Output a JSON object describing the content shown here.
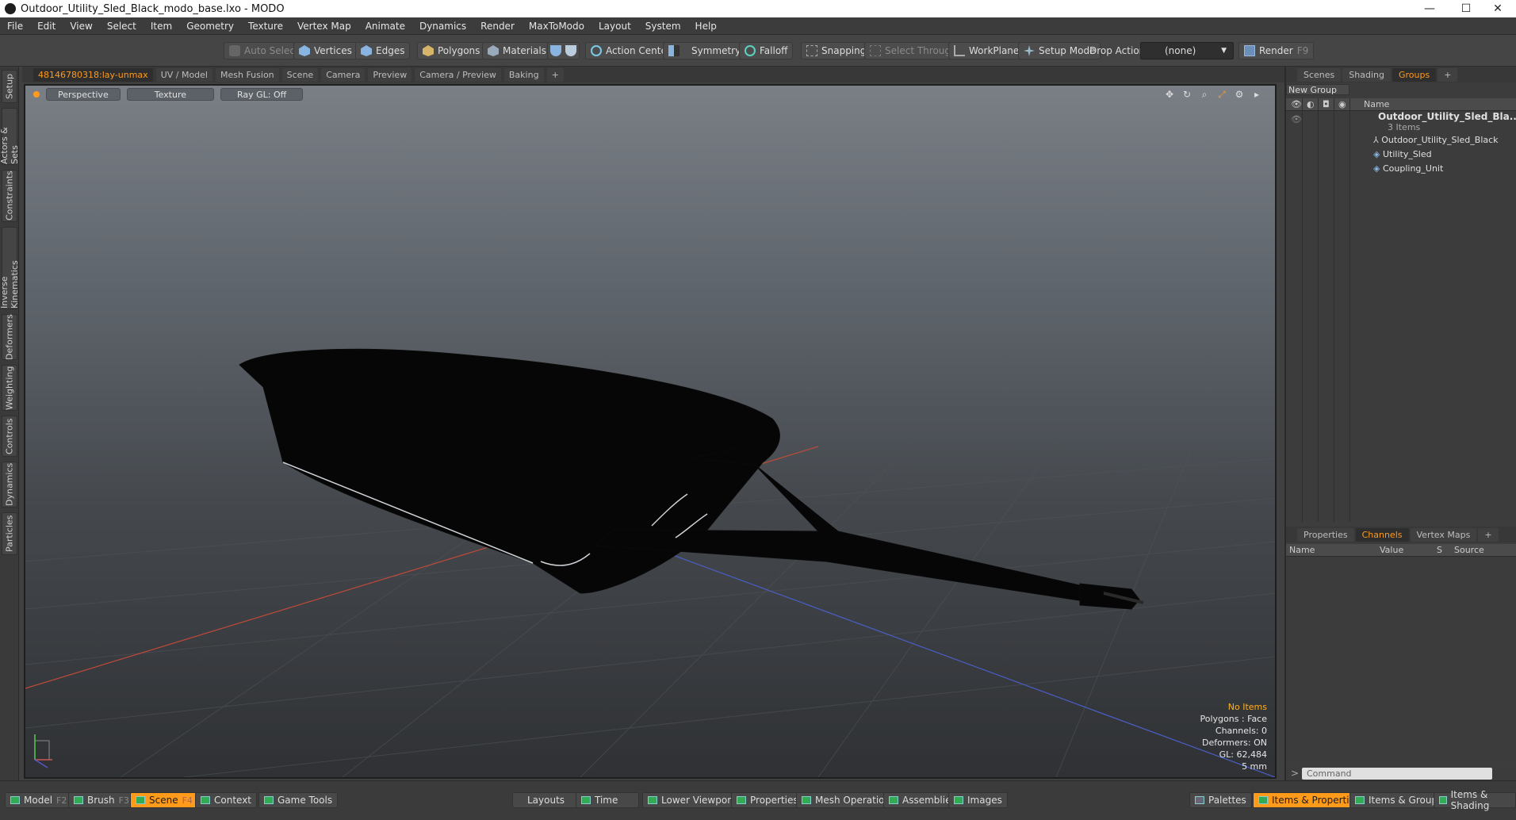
{
  "window": {
    "title": "Outdoor_Utility_Sled_Black_modo_base.lxo - MODO"
  },
  "menu": [
    "File",
    "Edit",
    "View",
    "Select",
    "Item",
    "Geometry",
    "Texture",
    "Vertex Map",
    "Animate",
    "Dynamics",
    "Render",
    "MaxToModo",
    "Layout",
    "System",
    "Help"
  ],
  "toolbar": {
    "auto_select": "Auto Select",
    "vertices": "Vertices",
    "edges": "Edges",
    "polygons": "Polygons",
    "materials": "Materials",
    "action_center": "Action Center",
    "symmetry": "Symmetry",
    "falloff": "Falloff",
    "snapping": "Snapping",
    "select_through": "Select Through",
    "workplane": "WorkPlane",
    "setup_mode": "Setup Mode",
    "drop_action": "Drop Action",
    "drop_value": "(none)",
    "render": "Render",
    "render_key": "F9"
  },
  "left_tabs": [
    "Setup",
    "Actors & Sets",
    "Constraints",
    "Inverse Kinematics",
    "Deformers",
    "Weighting",
    "Controls",
    "Dynamics",
    "Particles"
  ],
  "viewport_tabs": [
    "48146780318:lay-unmax",
    "UV / Model",
    "Mesh Fusion",
    "Scene",
    "Camera",
    "Preview",
    "Camera / Preview",
    "Baking",
    "+"
  ],
  "viewport": {
    "perspective": "Perspective",
    "texture": "Texture",
    "raygl": "Ray GL: Off",
    "info": {
      "items": "No Items",
      "polygons": "Polygons : Face",
      "channels": "Channels: 0",
      "deformers": "Deformers: ON",
      "gl": "GL: 62,484",
      "scale": "5 mm"
    }
  },
  "right_tabs": [
    "Scenes",
    "Shading",
    "Groups",
    "+"
  ],
  "groups": {
    "new_group": "New Group",
    "name_header": "Name",
    "root": "Outdoor_Utility_Sled_Bla...",
    "root_count": "3 Items",
    "children": [
      "Outdoor_Utility_Sled_Black",
      "Utility_Sled",
      "Coupling_Unit"
    ]
  },
  "channel_tabs": [
    "Properties",
    "Channels",
    "Vertex Maps",
    "+"
  ],
  "channels": {
    "name": "Name",
    "value": "Value",
    "s": "S",
    "source": "Source"
  },
  "command": {
    "placeholder": "Command"
  },
  "bottom": {
    "model": "Model",
    "model_key": "F2",
    "brush": "Brush",
    "brush_key": "F3",
    "scene": "Scene",
    "scene_key": "F4",
    "context": "Context",
    "game_tools": "Game Tools",
    "layouts": "Layouts",
    "time": "Time",
    "lower_viewports": "Lower Viewports",
    "properties": "Properties",
    "mesh_operations": "Mesh Operations",
    "assemblies": "Assemblies",
    "images": "Images",
    "palettes": "Palettes",
    "items_properties": "Items & Properties",
    "items_groups": "Items & Groups",
    "items_shading": "Items & Shading"
  },
  "colors": {
    "accent": "#ff9a1a",
    "viewport_top": "#7a7f86",
    "viewport_bottom": "#2f3134"
  }
}
